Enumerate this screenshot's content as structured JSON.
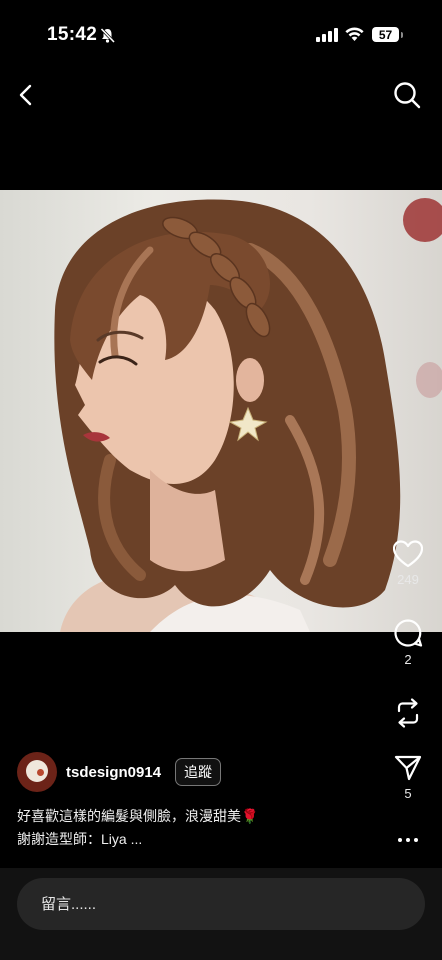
{
  "status_bar": {
    "time": "15:42",
    "battery": "57",
    "icons": [
      "bell-slash-icon",
      "signal-icon",
      "wifi-icon",
      "battery-icon"
    ]
  },
  "nav": {
    "back_icon": "chevron-left-icon",
    "search_icon": "search-icon"
  },
  "post": {
    "image_subject": "photo",
    "author": {
      "username": "tsdesign0914",
      "follow_label": "追蹤"
    },
    "caption_line1": "好喜歡這樣的編髮與側臉，浪漫甜美🌹",
    "caption_line2": "謝謝造型師：Liya ...",
    "actions": {
      "like_count": "249",
      "comment_count": "2",
      "repost_count": "",
      "share_count": "5"
    }
  },
  "comment_bar": {
    "placeholder": "留言......"
  },
  "colors": {
    "background": "#000000",
    "input_bg": "#262626",
    "bottom_bar": "#121212"
  }
}
